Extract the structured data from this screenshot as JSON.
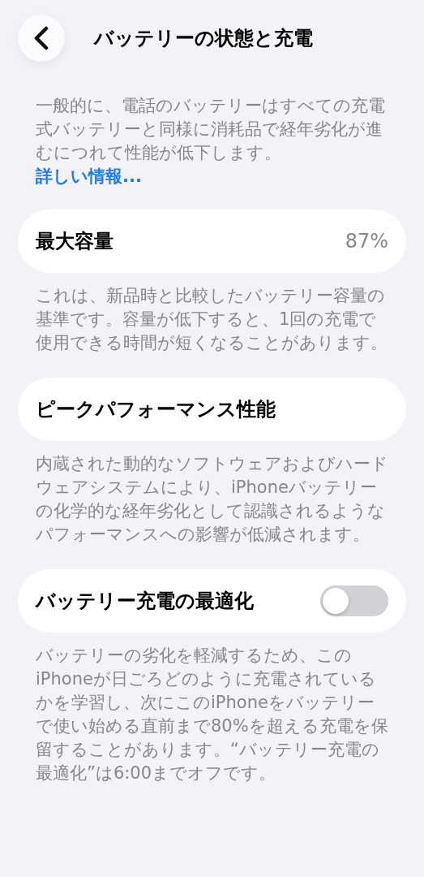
{
  "header": {
    "title": "バッテリーの状態と充電"
  },
  "intro": {
    "text": "一般的に、電話のバッテリーはすべての充電式バッテリーと同様に消耗品で経年劣化が進むにつれて性能が低下します。",
    "link": "詳しい情報..."
  },
  "sections": [
    {
      "kind": "value",
      "label": "最大容量",
      "value": "87%",
      "footer": "これは、新品時と比較したバッテリー容量の基準です。容量が低下すると、1回の充電で使用できる時間が短くなることがあります。"
    },
    {
      "kind": "plain",
      "label": "ピークパフォーマンス性能",
      "footer": "内蔵された動的なソフトウェアおよびハードウェアシステムにより、iPhoneバッテリーの化学的な経年劣化として認識されるようなパフォーマンスへの影響が低減されます。"
    },
    {
      "kind": "toggle",
      "label": "バッテリー充電の最適化",
      "on": false,
      "footer": "バッテリーの劣化を軽減するため、このiPhoneが日ごろどのように充電されているかを学習し、次にこのiPhoneをバッテリーで使い始める直前まで80%を超える充電を保留することがあります。“バッテリー充電の最適化”は6:00までオフです。"
    }
  ]
}
